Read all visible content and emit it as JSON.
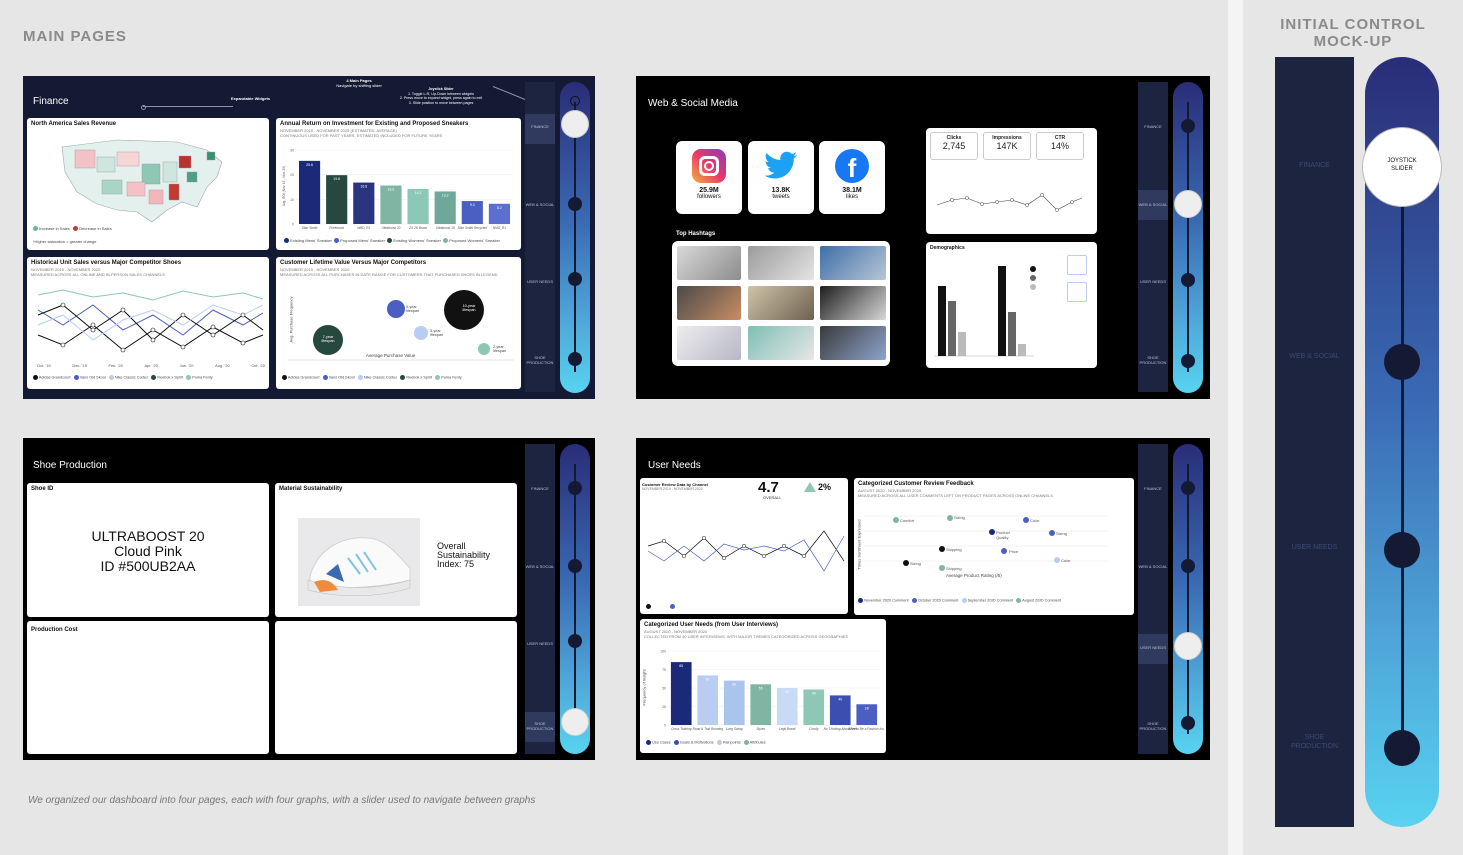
{
  "main_pages_title": "MAIN PAGES",
  "side_title_line1": "INITIAL CONTROL",
  "side_title_line2": "MOCK-UP",
  "caption": "We organized our dashboard into four pages, each with four graphs, with a slider used to navigate between graphs",
  "nav": {
    "finance": "FINANCE",
    "web_social": "WEB & SOCIAL",
    "web_social_short": "WEB & SOCIAL",
    "user_needs": "USER NEEDS",
    "shoe_production": "SHOE PRODUCTION"
  },
  "annotations": {
    "expandable": "Expandable Widgets",
    "four_pages_title": "4 Main Pages",
    "four_pages_sub": "Navigate by shifting slider",
    "joystick_title": "Joystick Slider",
    "joystick_1": "1. Toggle L-R, Up-Down between widgets",
    "joystick_2": "2. Press move to expand widget, press again to exit",
    "joystick_3": "3. Slide position to move between pages"
  },
  "finance": {
    "title": "Finance",
    "map_title": "North America Sales Revenue",
    "map_legend_inc": "Increase in Sales",
    "map_legend_dec": "Decrease in Sales",
    "map_note": "*Higher saturation = greater change",
    "roi_title": "Annual Return on Investment for Existing and Proposed Sneakers",
    "roi_sub1": "NOVEMBER 2015 - NOVEMBER 2025 (ESTIMATED, AVERAGE)",
    "roi_sub2": "CONTINUOUS USED FOR PAST YEARS, ESTIMATED INCLUDED FOR FUTURE YEARS",
    "roi_legend": [
      "Existing Mens' Sneaker",
      "Proposed Mens' Sneaker",
      "Existing Womens' Sneaker",
      "Proposed Womens' Sneaker"
    ],
    "hist_title": "Historical Unit Sales versus Major Competitor Shoes",
    "hist_sub1": "NOVEMBER 2019 - NOVEMBER 2020",
    "hist_sub2": "MEASURED ACROSS ALL ONLINE AND IN-PERSON SALES CHANNELS",
    "hist_x": [
      "Oct. '19",
      "Dec. '19",
      "Feb. '20",
      "Apr. '20",
      "Jun. '20",
      "Aug. '20",
      "Oct. '20"
    ],
    "clv_title": "Customer Lifetime Value Versus Major Competitors",
    "clv_sub1": "NOVEMBER 2019 - NOVEMBER 2020",
    "clv_sub2": "MEASURED ACROSS ALL PURCHASES IN DATE RANGE FOR CUSTOMERS THAT PURCHASED SHOES IN LEGEND",
    "clv_xlabel": "Average Purchase Value",
    "clv_ylabel": "Avg. Purchase Frequency",
    "clv_bubbles": [
      "10-year lifespan",
      "5-year lifespan",
      "3-year lifespan",
      "7-year lifespan",
      "2-year lifespan"
    ],
    "brand_legend": [
      "Adidas Grandcourt",
      "Vans Old Skool",
      "Nike Classic Cortez",
      "Reebok x Spirit",
      "Puma Fenty"
    ]
  },
  "web": {
    "title": "Web & Social Media",
    "instagram_value": "25.9M",
    "instagram_label": "followers",
    "twitter_value": "13.8K",
    "twitter_label": "tweets",
    "facebook_value": "38.1M",
    "facebook_label": "likes",
    "hashtags_title": "Top Hashtags",
    "kpis": [
      {
        "label": "Clicks",
        "value": "2,745"
      },
      {
        "label": "Impressions",
        "value": "147K"
      },
      {
        "label": "CTR",
        "value": "14%"
      }
    ],
    "demographics_title": "Demographics"
  },
  "shoe": {
    "title": "Shoe Production",
    "shoe_id_title": "Shoe ID",
    "shoe_line1": "ULTRABOOST 20",
    "shoe_line2": "Cloud Pink",
    "shoe_line3": "ID #500UB2AA",
    "sust_title": "Material Sustainability",
    "sust_line1": "Overall",
    "sust_line2": "Sustainability",
    "sust_line3": "Index: 75",
    "cost_title": "Production Cost"
  },
  "user": {
    "title": "User Needs",
    "review_title": "Customer Review Data by Channel",
    "review_sub": "NOVEMBER 2019 - NOVEMBER 2020",
    "rating": "4.7",
    "rating_label": "OVERALL",
    "rating_change": "2%",
    "feedback_title": "Categorized Customer Review Feedback",
    "feedback_sub1": "AUGUST 2020 - NOVEMBER 2020",
    "feedback_sub2": "MEASURED ACROSS ALL USER COMMENTS LEFT ON PRODUCT PAGES ACROSS ONLINE CHANNELS",
    "feedback_xlabel": "Average Product Rating (/5)",
    "feedback_ylabel": "Times Sentiment Expressed",
    "feedback_points": [
      "Comfort",
      "Sizing",
      "Color",
      "Product Quality",
      "Sizing",
      "Shipping",
      "Price",
      "Sizing",
      "Shipping",
      "Color"
    ],
    "feedback_legend": [
      "November 2020 Comment",
      "October 2020 Comment",
      "September 2020 Comment",
      "August 2020 Comment"
    ],
    "needs_title": "Categorized User Needs (from User Interviews)",
    "needs_sub1": "AUGUST 2020 - NOVEMBER 2020",
    "needs_sub2": "COLLECTED FROM 40 USER INTERVIEWS, WITH MAJOR THEMES CATEGORIZED ACROSS GEOGRAPHIES",
    "needs_ylabel": "Frequency of Insight",
    "needs_legend": [
      "Use Cases",
      "Goals & Motivations",
      "Painpoints",
      "Attributes"
    ]
  },
  "side": {
    "knob_label_1": "JOYSTICK",
    "knob_label_2": "SLIDER"
  },
  "chart_data": [
    {
      "type": "bar",
      "title": "Annual Return on Investment for Existing and Proposed Sneakers",
      "categories": [
        "Stan Smith",
        "Pureboost",
        "NMD_R1",
        "Ultraboost 20",
        "ZX 2K Boost",
        "Ultraboost 19",
        "Stan Smith Recycled",
        "NMD_R1"
      ],
      "values": [
        25.6,
        19.8,
        16.8,
        15.6,
        14.2,
        13.2,
        9.3,
        8.2
      ],
      "ylim": [
        0,
        30
      ],
      "ylabel": "Avg. ROI (Nov. 15 - Nov. 25)",
      "colors": [
        "#1b2a78",
        "#26483f",
        "#2a3580",
        "#7fb5a2",
        "#8dc7b5",
        "#6fa89a",
        "#4a5fc1",
        "#5b6fd0"
      ]
    },
    {
      "type": "bar",
      "title": "Categorized User Needs (from User Interviews)",
      "categories": [
        "Cross Training",
        "Road & Trail Running",
        "Long Swing",
        "Styles",
        "Legit Brand",
        "Comfy",
        "No Thinking About Feet",
        "Want to Be a Fashion Icon"
      ],
      "values": [
        85,
        67,
        60,
        55,
        50,
        48,
        40,
        28
      ],
      "ylim": [
        0,
        100
      ],
      "colors": [
        "#1b2a78",
        "#b9cdf3",
        "#aac4ee",
        "#7fb5a2",
        "#c9daf6",
        "#8dc7b5",
        "#3b4fb0",
        "#4a5fc1"
      ]
    }
  ]
}
